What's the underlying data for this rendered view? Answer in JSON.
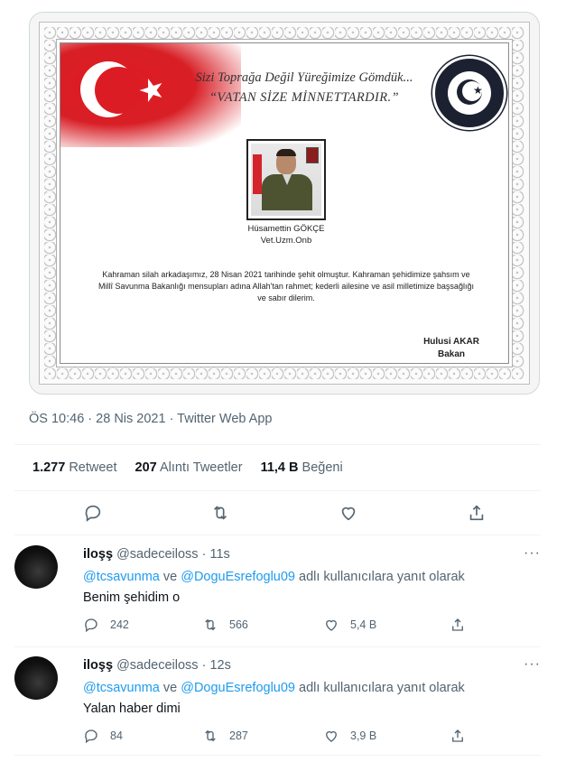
{
  "card": {
    "motto_line1": "Sizi Toprağa Değil Yüreğimize Gömdük...",
    "motto_line2": "“VATAN SİZE MİNNETTARDIR.”",
    "soldier_name": "Hüsamettin GÖKÇE",
    "soldier_rank": "Vet.Uzm.Onb",
    "body": "Kahraman silah arkadaşımız, 28 Nisan 2021 tarihinde şehit olmuştur. Kahraman şehidimize şahsım ve Millî Savunma Bakanlığı mensupları adına Allah'tan rahmet; kederli ailesine ve asil milletimize başsağlığı ve sabır dilerim.",
    "signer_name": "Hulusi AKAR",
    "signer_title": "Bakan"
  },
  "meta": {
    "time": "ÖS 10:46",
    "sep1": " · ",
    "date": "28 Nis 2021",
    "sep2": " · ",
    "source": "Twitter Web App"
  },
  "stats": [
    {
      "count": "1.277",
      "label": "Retweet"
    },
    {
      "count": "207",
      "label": "Alıntı Tweetler"
    },
    {
      "count": "11,4 B",
      "label": "Beğeni"
    }
  ],
  "actions": [
    "reply-icon",
    "retweet-icon",
    "like-icon",
    "share-icon"
  ],
  "replies": [
    {
      "name": "iloşş",
      "handle": "@sadeceiloss",
      "dot": "·",
      "time": "11s",
      "more": "···",
      "mention1": "@tcsavunma",
      "and": " ve ",
      "mention2": "@DoguEsrefoglu09",
      "replying_suffix": " adlı kullanıcılara yanıt olarak",
      "text": "Benim şehidim o",
      "reply_count": "242",
      "retweet_count": "566",
      "like_count": "5,4 B"
    },
    {
      "name": "iloşş",
      "handle": "@sadeceiloss",
      "dot": "·",
      "time": "12s",
      "more": "···",
      "mention1": "@tcsavunma",
      "and": " ve ",
      "mention2": "@DoguEsrefoglu09",
      "replying_suffix": " adlı kullanıcılara yanıt olarak",
      "text": "Yalan haber dimi",
      "reply_count": "84",
      "retweet_count": "287",
      "like_count": "3,9 B"
    }
  ]
}
